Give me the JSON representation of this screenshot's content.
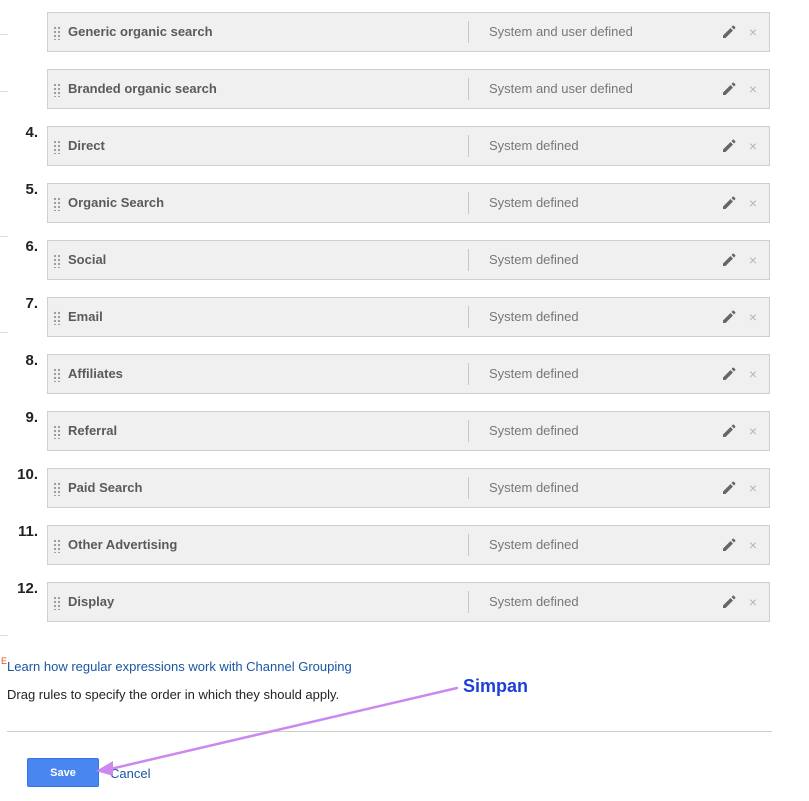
{
  "rules": [
    {
      "number": "",
      "name": "Generic organic search",
      "type": "System and user defined"
    },
    {
      "number": "",
      "name": "Branded organic search",
      "type": "System and user defined"
    },
    {
      "number": "4.",
      "name": "Direct",
      "type": "System defined"
    },
    {
      "number": "5.",
      "name": "Organic Search",
      "type": "System defined"
    },
    {
      "number": "6.",
      "name": "Social",
      "type": "System defined"
    },
    {
      "number": "7.",
      "name": "Email",
      "type": "System defined"
    },
    {
      "number": "8.",
      "name": "Affiliates",
      "type": "System defined"
    },
    {
      "number": "9.",
      "name": "Referral",
      "type": "System defined"
    },
    {
      "number": "10.",
      "name": "Paid Search",
      "type": "System defined"
    },
    {
      "number": "11.",
      "name": "Other Advertising",
      "type": "System defined"
    },
    {
      "number": "12.",
      "name": "Display",
      "type": "System defined"
    }
  ],
  "icons": {
    "edit": "pencil-icon",
    "remove": "close-icon",
    "drag": "drag-handle-icon"
  },
  "help": {
    "marker": "E",
    "link_text": "Learn how regular expressions work with Channel Grouping"
  },
  "instruction": "Drag rules to specify the order in which they should apply.",
  "actions": {
    "save_label": "Save",
    "cancel_label": "Cancel"
  },
  "annotation": {
    "label": "Simpan",
    "color": "#cc88ee"
  },
  "colors": {
    "primary_button": "#4a86f0",
    "link": "#1a56a5",
    "annotation_text": "#1f3fd8"
  }
}
